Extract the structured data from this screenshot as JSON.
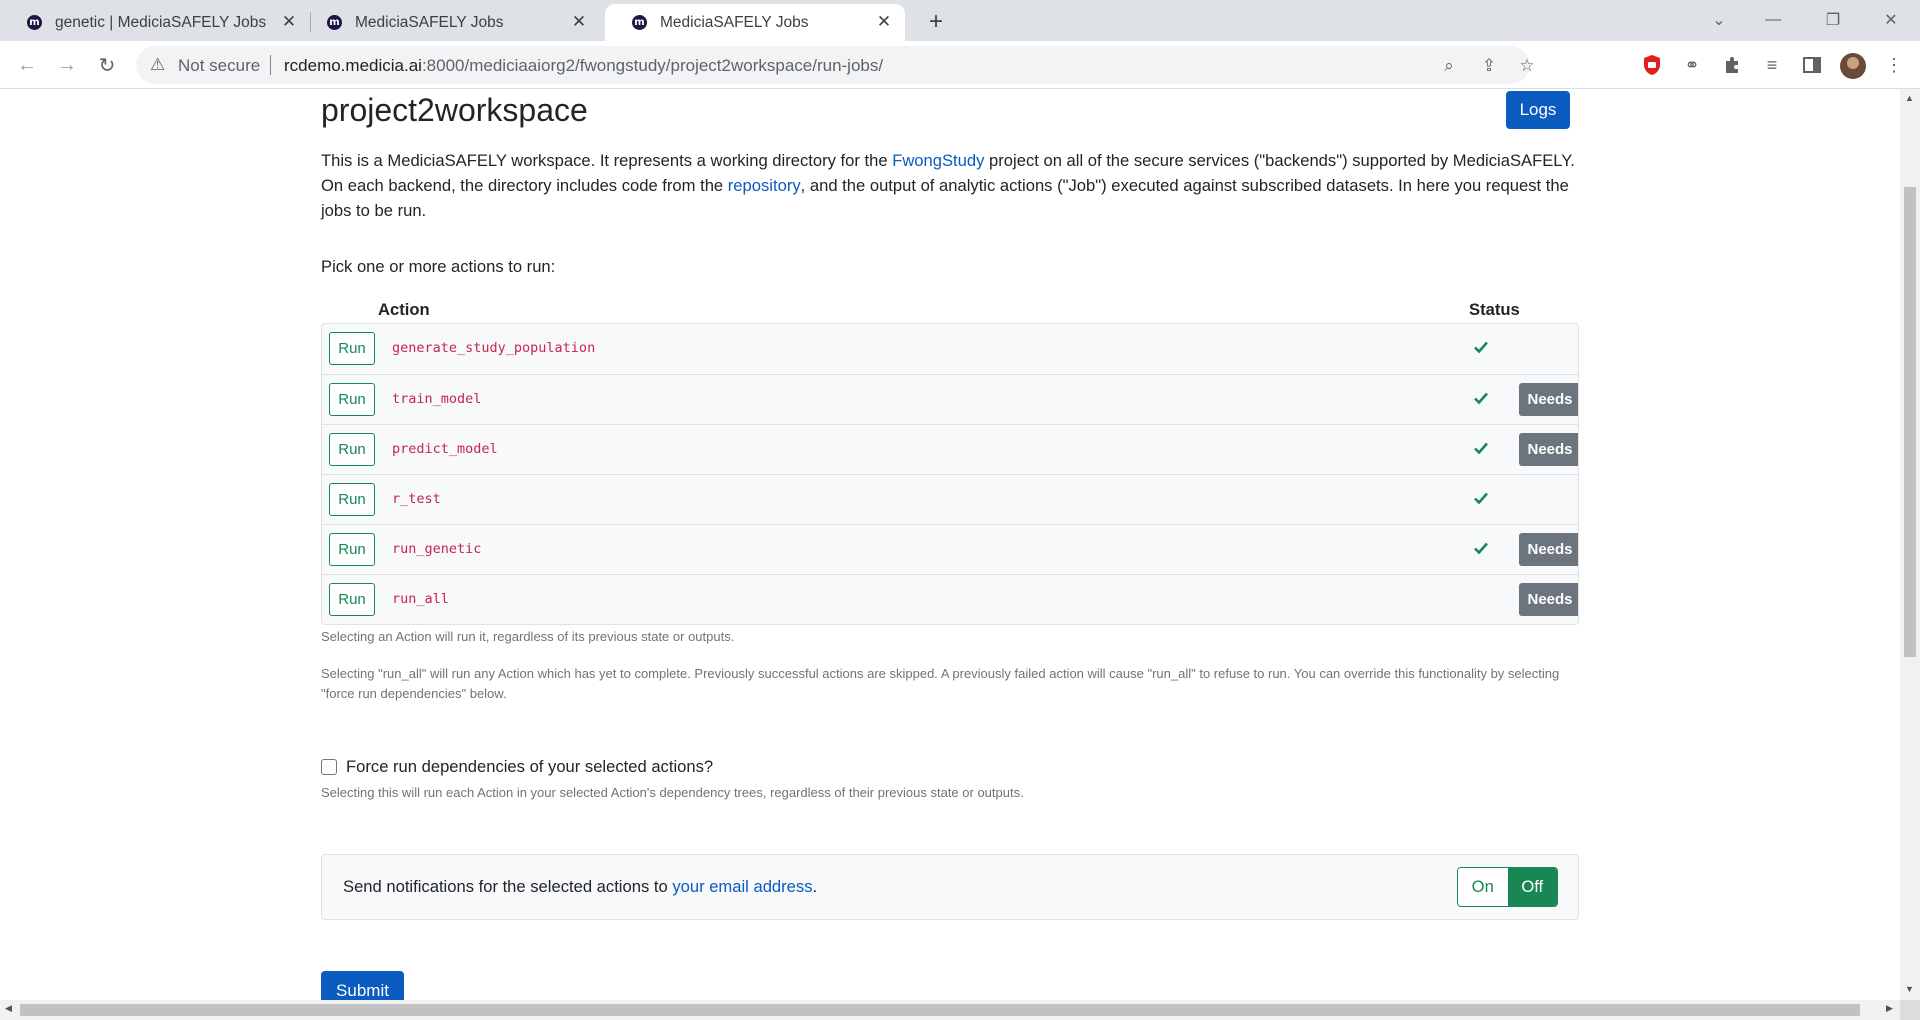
{
  "browser": {
    "tabs": [
      {
        "title": "genetic | MediciaSAFELY Jobs",
        "active": false
      },
      {
        "title": "MediciaSAFELY Jobs",
        "active": false
      },
      {
        "title": "MediciaSAFELY Jobs",
        "active": true
      }
    ],
    "favicon_letter": "m",
    "security_label": "Not secure",
    "url_host": "rcdemo.medicia.ai",
    "url_rest": ":8000/mediciaaiorg2/fwongstudy/project2workspace/run-jobs/"
  },
  "page": {
    "title": "project2workspace",
    "logs_button": "Logs",
    "intro": {
      "part1": "This is a MediciaSAFELY workspace. It represents a working directory for the ",
      "study_link": "FwongStudy",
      "part2": " project on all of the secure services (\"backends\") supported by MediciaSAFELY. On each backend, the directory includes code from the ",
      "repo_link": "repository",
      "part3": ", and the output of analytic actions (\"Job\") executed against subscribed datasets. In here you request the jobs to be run."
    },
    "pick_label": "Pick one or more actions to run:",
    "table": {
      "action_header": "Action",
      "status_header": "Status",
      "run_label": "Run",
      "needs_label": "Needs",
      "rows": [
        {
          "name": "generate_study_population",
          "status": "success",
          "needs": false
        },
        {
          "name": "train_model",
          "status": "success",
          "needs": true
        },
        {
          "name": "predict_model",
          "status": "success",
          "needs": true
        },
        {
          "name": "r_test",
          "status": "success",
          "needs": false
        },
        {
          "name": "run_genetic",
          "status": "success",
          "needs": true
        },
        {
          "name": "run_all",
          "status": "",
          "needs": true
        }
      ]
    },
    "help_select": "Selecting an Action will run it, regardless of its previous state or outputs.",
    "help_run_all": "Selecting \"run_all\" will run any Action which has yet to complete. Previously successful actions are skipped. A previously failed action will cause \"run_all\" to refuse to run. You can override this functionality by selecting \"force run dependencies\" below.",
    "force_label": "Force run dependencies of your selected actions?",
    "force_checked": false,
    "force_help": "Selecting this will run each Action in your selected Action's dependency trees, regardless of their previous state or outputs.",
    "notify": {
      "text_before": "Send notifications for the selected actions to ",
      "link": "your email address",
      "text_after": ".",
      "on_label": "On",
      "off_label": "Off",
      "selected": "Off"
    },
    "submit_button": "Submit"
  },
  "colors": {
    "primary": "#0b5bc0",
    "success": "#198754",
    "action_name": "#c7254e",
    "needs_badge": "#6c757d"
  }
}
